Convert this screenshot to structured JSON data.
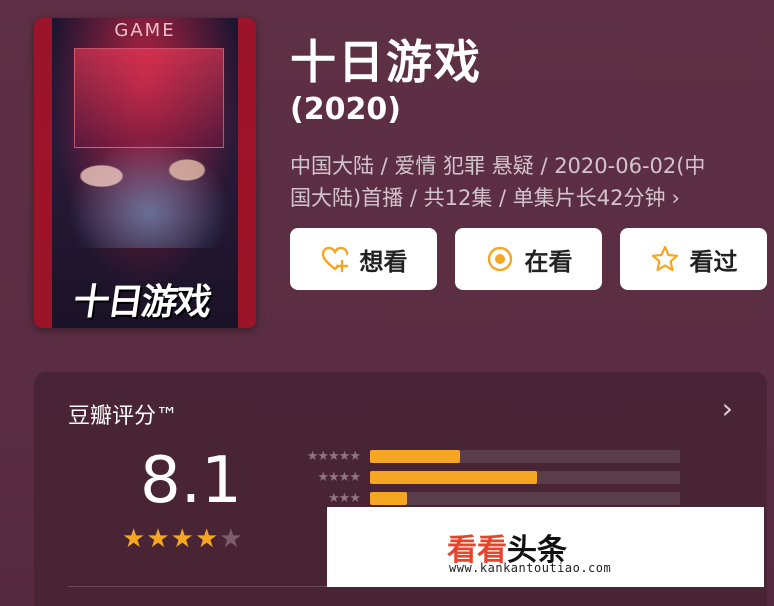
{
  "movie": {
    "poster_top_text": "GAME",
    "poster_title": "十日游戏",
    "title": "十日游戏",
    "year": "(2020)",
    "meta_line1": "中国大陆 / 爱情 犯罪 悬疑 / 2020-06-02(中",
    "meta_line2": "国大陆)首播 / 共12集 / 单集片长42分钟",
    "meta_chevron": "›"
  },
  "actions": {
    "want": "想看",
    "watching": "在看",
    "watched": "看过"
  },
  "rating": {
    "label": "豆瓣评分™",
    "chevron": "›",
    "score": "8.1",
    "stars_filled": 4,
    "stars_total": 5,
    "distribution": [
      {
        "stars": "★★★★★",
        "fraction": 0.29
      },
      {
        "stars": "★★★★",
        "fraction": 0.54
      },
      {
        "stars": "★★★",
        "fraction": 0.12
      }
    ]
  },
  "watermark": {
    "logo_red": "看看",
    "logo_black": "头条",
    "url": "www.kankantoutiao.com"
  },
  "colors": {
    "background": "#5a2e42",
    "accent": "#f5a623",
    "card": "#46233a"
  },
  "icons": {
    "want": "heart-plus-icon",
    "watching": "target-circle-icon",
    "watched": "star-outline-icon"
  }
}
